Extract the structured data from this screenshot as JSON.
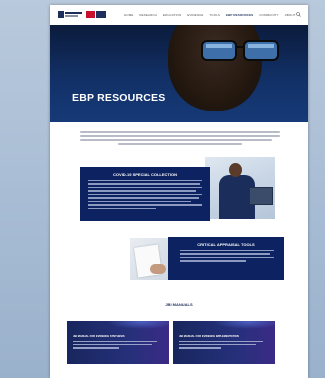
{
  "nav": {
    "items": [
      "HOME",
      "RESEARCH",
      "EDUCATION",
      "EVIDENCE",
      "TOOLS",
      "EBP RESOURCES",
      "COMMUNITY",
      "ABOUT"
    ],
    "active_index": 5
  },
  "hero": {
    "title": "EBP RESOURCES"
  },
  "sections": {
    "covid": {
      "title": "COVID-19 SPECIAL COLLECTION"
    },
    "critical": {
      "title": "CRITICAL APPRAISAL TOOLS"
    },
    "jbi": {
      "title": "JBI MANUALS"
    }
  },
  "manuals": [
    {
      "title": "JBI MANUAL FOR EVIDENCE SYNTHESIS"
    },
    {
      "title": "JBI MANUAL FOR EVIDENCE IMPLEMENTATION"
    }
  ],
  "colors": {
    "brand_navy": "#0d2260",
    "hero_blue": "#163a78",
    "frame_blue": "#a7bcd4"
  },
  "icons": [
    "search-icon",
    "logo-university",
    "logo-jbi"
  ]
}
